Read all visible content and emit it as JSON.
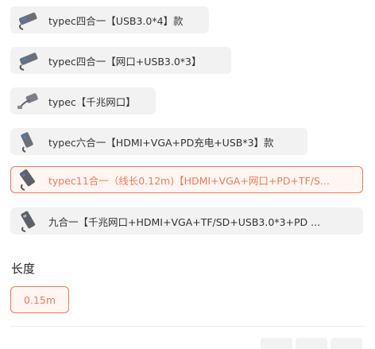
{
  "options": [
    {
      "label": "typec四合一【USB3.0*4】款",
      "icon": "usb-hub-thumbnail",
      "selected": false
    },
    {
      "label": "typec四合一【网口+USB3.0*3】",
      "icon": "usb-hub-thumbnail",
      "selected": false
    },
    {
      "label": "typec【千兆网口】",
      "icon": "ethernet-adapter-thumbnail",
      "selected": false
    },
    {
      "label": "typec六合一【HDMI+VGA+PD充电+USB*3】款",
      "icon": "usb-hub-thumbnail",
      "selected": false
    },
    {
      "label": "typec11合一（线长0.12m)【HDMI+VGA+网口+PD+TF/S...",
      "icon": "usb-hub-thumbnail",
      "selected": true
    },
    {
      "label": "九合一【千兆网口+HDMI+VGA+TF/SD+USB3.0*3+PD ...",
      "icon": "usb-hub-thumbnail",
      "selected": false
    }
  ],
  "length_section": {
    "title": "长度",
    "options": [
      {
        "label": "0.15m",
        "selected": true
      }
    ]
  },
  "colors": {
    "accent": "#f07a55",
    "option_bg": "#f2f2f3",
    "text": "#333333"
  }
}
